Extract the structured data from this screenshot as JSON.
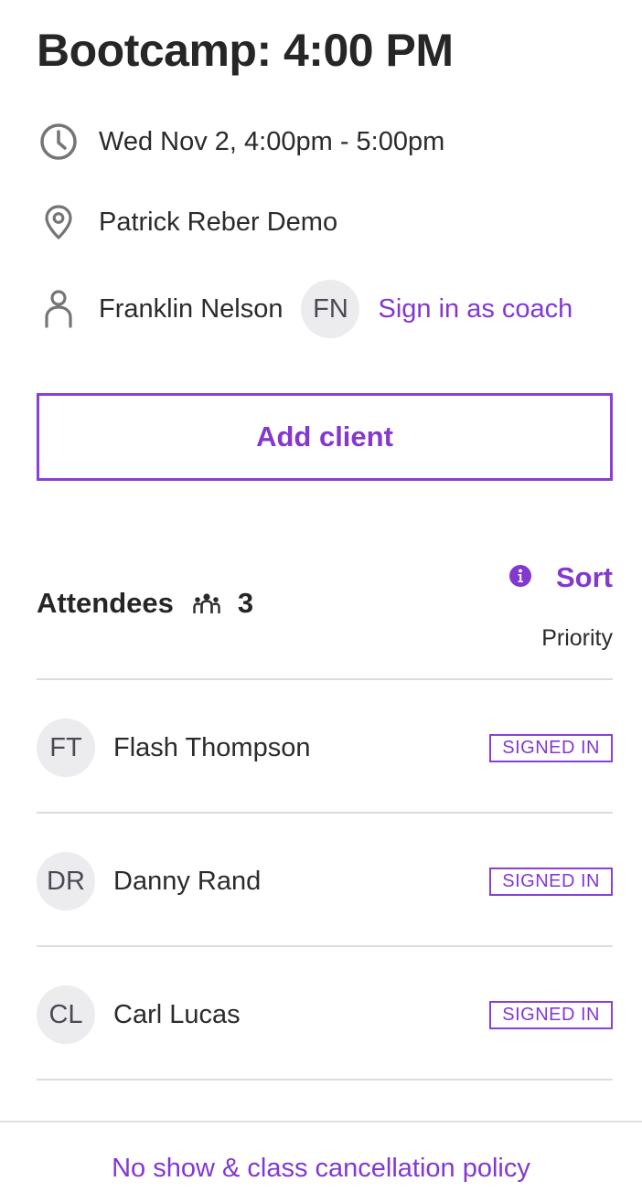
{
  "event": {
    "title": "Bootcamp: 4:00 PM",
    "datetime": "Wed Nov 2, 4:00pm - 5:00pm",
    "location": "Patrick Reber Demo",
    "coach_name": "Franklin Nelson",
    "coach_initials": "FN",
    "coach_action": "Sign in as coach"
  },
  "actions": {
    "add_client": "Add client"
  },
  "attendees": {
    "label": "Attendees",
    "count": "3",
    "sort_label": "Sort",
    "sort_value": "Priority",
    "list": [
      {
        "initials": "FT",
        "name": "Flash Thompson",
        "status": "SIGNED IN"
      },
      {
        "initials": "DR",
        "name": "Danny Rand",
        "status": "SIGNED IN"
      },
      {
        "initials": "CL",
        "name": "Carl Lucas",
        "status": "SIGNED IN"
      }
    ]
  },
  "footer": {
    "policy_link": "No show & class cancellation policy"
  },
  "icons": {
    "time": "clock-icon",
    "location": "map-pin-icon",
    "coach": "person-icon",
    "attendees": "group-icon",
    "sort_info": "info-icon"
  },
  "colors": {
    "accent": "#8338d0",
    "text": "#2b2b2b",
    "avatar_bg": "#ececef",
    "divider": "#dcdcdf"
  }
}
